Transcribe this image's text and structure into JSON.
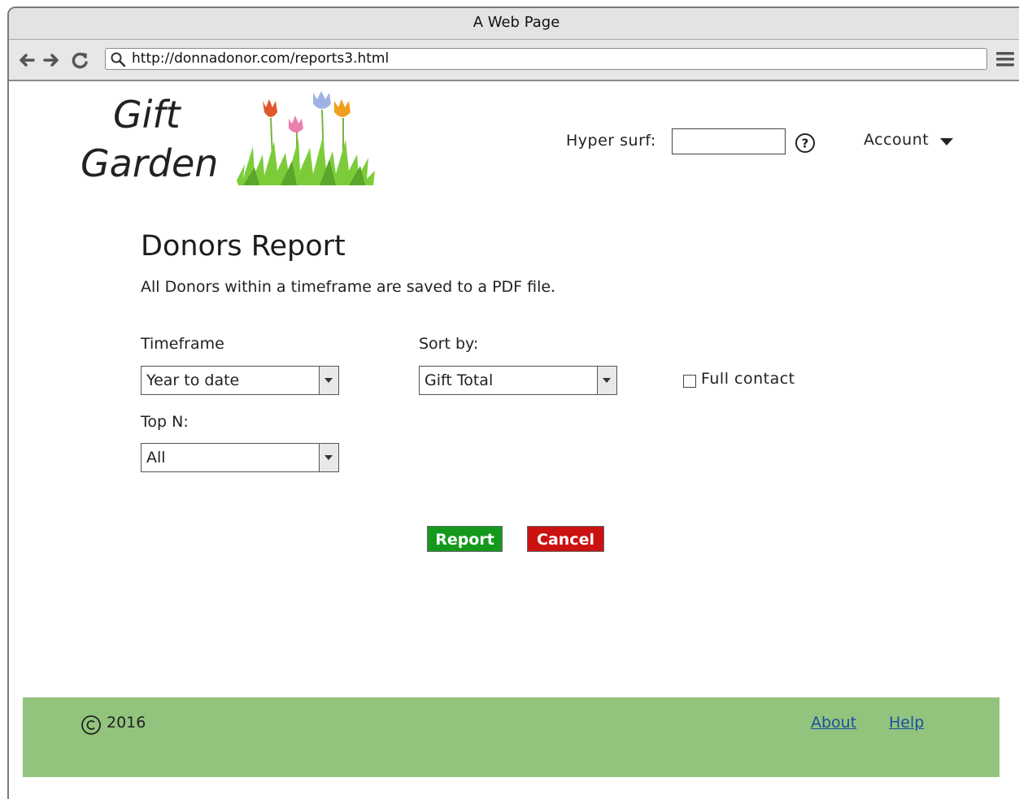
{
  "browser": {
    "title": "A Web Page",
    "url": "http://donnadonor.com/reports3.html"
  },
  "logo": {
    "line1": "Gift",
    "line2": "Garden"
  },
  "header": {
    "hyper_surf_label": "Hyper surf:",
    "hyper_surf_value": "",
    "account_label": "Account"
  },
  "report": {
    "title": "Donors Report",
    "subtitle": "All Donors within a timeframe are saved to a PDF file.",
    "timeframe_label": "Timeframe",
    "timeframe_value": "Year to date",
    "sort_label": "Sort by:",
    "sort_value": "Gift Total",
    "full_contact_label": "Full contact",
    "full_contact_checked": false,
    "topn_label": "Top N:",
    "topn_value": "All",
    "report_button": "Report",
    "cancel_button": "Cancel"
  },
  "footer": {
    "copyright": "2016",
    "about": "About",
    "help": "Help"
  },
  "colors": {
    "footer_bg": "#93c47d",
    "report_btn": "#14991c",
    "cancel_btn": "#cc1111",
    "link": "#1b4fa0"
  }
}
